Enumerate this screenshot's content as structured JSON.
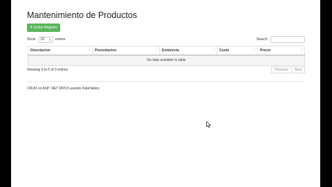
{
  "page": {
    "title": "Mantenimiento de Productos",
    "add_button": {
      "label": "Incluir Registro",
      "icon": "plus-icon"
    },
    "length": {
      "show_label": "Show",
      "value": "10",
      "entries_label": "entries"
    },
    "search": {
      "label": "Search:",
      "value": ""
    },
    "table": {
      "columns": [
        {
          "label": "Descripcion",
          "sort": "ascending"
        },
        {
          "label": "Presentacion",
          "sort": "none"
        },
        {
          "label": "Existencia",
          "sort": "none"
        },
        {
          "label": "Costo",
          "sort": "none"
        },
        {
          "label": "Precio",
          "sort": "none"
        }
      ],
      "empty_message": "No data available in table"
    },
    "info": "Showing 0 to 0 of 0 entries",
    "pager": {
      "previous": "Previous",
      "next": "Next"
    },
    "footer": "CRUD en ASP .NET MVC5 usando DataTables"
  },
  "colors": {
    "add_button": "#5cb85c",
    "background_frame": "#000000"
  }
}
